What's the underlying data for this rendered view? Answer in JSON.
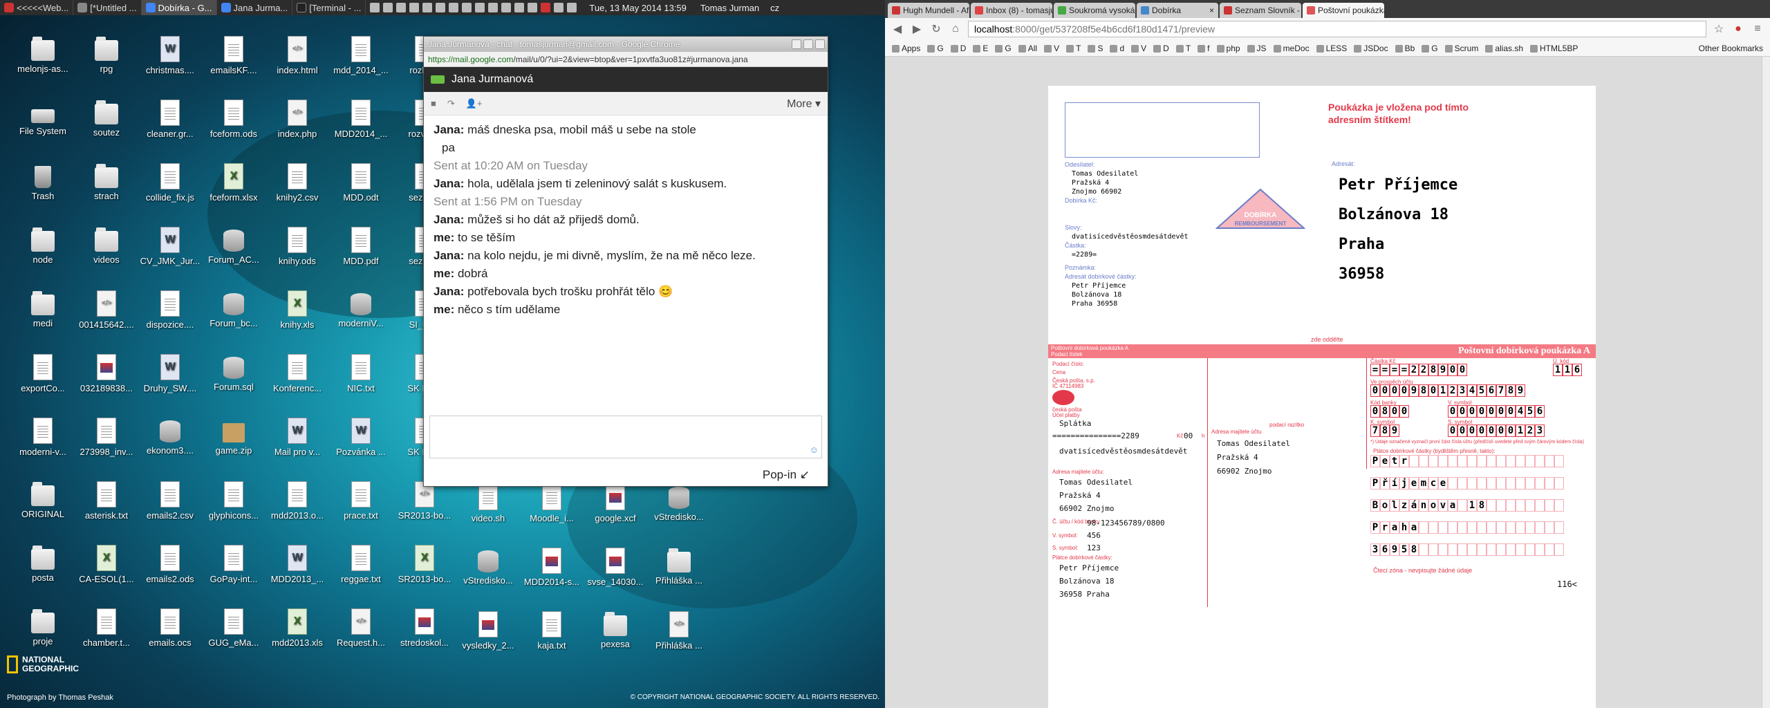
{
  "taskbar": {
    "items": [
      "<<<<<Web...",
      "[*Untitled ...",
      "Dobírka - G...",
      "Jana Jurma...",
      "[Terminal - ..."
    ],
    "clock": "Tue, 13 May 2014 13:59",
    "user": "Tomas Jurman",
    "lang": "cz"
  },
  "desktop": {
    "icons": [
      {
        "label": "melonjs-as...",
        "type": "folder"
      },
      {
        "label": "rpg",
        "type": "folder"
      },
      {
        "label": "christmas....",
        "type": "word"
      },
      {
        "label": "emailsKF....",
        "type": "doc"
      },
      {
        "label": "index.html",
        "type": "html"
      },
      {
        "label": "mdd_2014_...",
        "type": "doc"
      },
      {
        "label": "rozho...",
        "type": "doc"
      },
      {
        "label": "File System",
        "type": "drive"
      },
      {
        "label": "soutez",
        "type": "folder"
      },
      {
        "label": "cleaner.gr...",
        "type": "doc"
      },
      {
        "label": "fceform.ods",
        "type": "doc"
      },
      {
        "label": "index.php",
        "type": "html"
      },
      {
        "label": "MDD2014_...",
        "type": "doc"
      },
      {
        "label": "rozvrh...",
        "type": "doc"
      },
      {
        "label": "Trash",
        "type": "trash"
      },
      {
        "label": "strach",
        "type": "folder"
      },
      {
        "label": "collide_fix.js",
        "type": "doc"
      },
      {
        "label": "fceform.xlsx",
        "type": "sheet"
      },
      {
        "label": "knihy2.csv",
        "type": "doc"
      },
      {
        "label": "MDD.odt",
        "type": "doc"
      },
      {
        "label": "sezna...",
        "type": "doc"
      },
      {
        "label": "node",
        "type": "folder"
      },
      {
        "label": "videos",
        "type": "folder"
      },
      {
        "label": "CV_JMK_Jur...",
        "type": "word"
      },
      {
        "label": "Forum_AC...",
        "type": "db"
      },
      {
        "label": "knihy.ods",
        "type": "doc"
      },
      {
        "label": "MDD.pdf",
        "type": "doc"
      },
      {
        "label": "sezna...",
        "type": "doc"
      },
      {
        "label": "medi",
        "type": "folder"
      },
      {
        "label": "001415642....",
        "type": "html"
      },
      {
        "label": "dispozice....",
        "type": "doc"
      },
      {
        "label": "Forum_bc...",
        "type": "db"
      },
      {
        "label": "knihy.xls",
        "type": "sheet"
      },
      {
        "label": "moderniV...",
        "type": "db"
      },
      {
        "label": "SI_05...",
        "type": "doc"
      },
      {
        "label": "exportCo...",
        "type": "doc"
      },
      {
        "label": "032189838...",
        "type": "img"
      },
      {
        "label": "Druhy_SW....",
        "type": "word"
      },
      {
        "label": "Forum.sql",
        "type": "db"
      },
      {
        "label": "Konferenc...",
        "type": "doc"
      },
      {
        "label": "NIC.txt",
        "type": "doc"
      },
      {
        "label": "SK BA...",
        "type": "doc"
      },
      {
        "label": "moderni-v...",
        "type": "doc"
      },
      {
        "label": "273998_inv...",
        "type": "doc"
      },
      {
        "label": "ekonom3....",
        "type": "db"
      },
      {
        "label": "game.zip",
        "type": "zip"
      },
      {
        "label": "Mail pro v...",
        "type": "word"
      },
      {
        "label": "Pozvánka ...",
        "type": "word"
      },
      {
        "label": "SK BA...",
        "type": "doc"
      },
      {
        "label": "ORIGINAL",
        "type": "folder"
      },
      {
        "label": "asterisk.txt",
        "type": "doc"
      },
      {
        "label": "emails2.csv",
        "type": "doc"
      },
      {
        "label": "glyphicons...",
        "type": "doc"
      },
      {
        "label": "mdd2013.o...",
        "type": "doc"
      },
      {
        "label": "prace.txt",
        "type": "doc"
      },
      {
        "label": "SR2013-bo...",
        "type": "html"
      },
      {
        "label": "posta",
        "type": "folder"
      },
      {
        "label": "CA-ESOL(1...",
        "type": "sheet"
      },
      {
        "label": "emails2.ods",
        "type": "doc"
      },
      {
        "label": "GoPay-int...",
        "type": "doc"
      },
      {
        "label": "MDD2013_...",
        "type": "word"
      },
      {
        "label": "reggae.txt",
        "type": "doc"
      },
      {
        "label": "SR2013-bo...",
        "type": "sheet"
      },
      {
        "label": "proje",
        "type": "folder"
      },
      {
        "label": "chamber.t...",
        "type": "doc"
      },
      {
        "label": "emails.ocs",
        "type": "doc"
      },
      {
        "label": "GUG_eMa...",
        "type": "doc"
      },
      {
        "label": "mdd2013.xls",
        "type": "sheet"
      },
      {
        "label": "Request.h...",
        "type": "html"
      },
      {
        "label": "stredoskol...",
        "type": "img"
      }
    ],
    "extra_icons": [
      {
        "label": "video.sh",
        "type": "doc"
      },
      {
        "label": "Moodle_i...",
        "type": "doc"
      },
      {
        "label": "google.xcf",
        "type": "img"
      },
      {
        "label": "vStredisko...",
        "type": "db"
      },
      {
        "label": "vStredisko...",
        "type": "db"
      },
      {
        "label": "MDD2014-s...",
        "type": "img"
      },
      {
        "label": "svse_14030...",
        "type": "img"
      },
      {
        "label": "Přihláška ...",
        "type": "folder"
      },
      {
        "label": "vysledky_2...",
        "type": "img"
      },
      {
        "label": "kaja.txt",
        "type": "doc"
      },
      {
        "label": "pexesa",
        "type": "folder"
      },
      {
        "label": "Přihláška ...",
        "type": "html"
      }
    ],
    "natgeo_line1": "NATIONAL",
    "natgeo_line2": "GEOGRAPHIC",
    "photo_credit": "Photograph by Thomas Peshak",
    "copyright": "© COPYRIGHT NATIONAL GEOGRAPHIC SOCIETY. ALL RIGHTS RESERVED."
  },
  "chat": {
    "window_title": "Jana Jurmanová - chat - tomasjurman@gmail.com - Google Chrome",
    "url_secure": "https://mail.google.com",
    "url_rest": "/mail/u/0/?ui=2&view=btop&ver=1pxvtfa3uo81z#jurmanova.jana",
    "contact": "Jana Jurmanová",
    "more": "More ▾",
    "popin": "Pop-in ↙",
    "messages": [
      {
        "who": "Jana:",
        "text": "máš dneska psa, mobil máš u sebe na stole"
      },
      {
        "who": "",
        "text": "pa"
      },
      {
        "ts": "Sent at 10:20 AM on Tuesday"
      },
      {
        "who": "Jana:",
        "text": "hola, udělala jsem ti zeleninový salát s kuskusem."
      },
      {
        "ts": "Sent at 1:56 PM on Tuesday"
      },
      {
        "who": "Jana:",
        "text": "můžeš si ho dát až přijedš domů."
      },
      {
        "who": "me:",
        "text": "to se těším"
      },
      {
        "who": "Jana:",
        "text": "na kolo nejdu, je mi divně, myslím, že na mě něco leze."
      },
      {
        "who": "me:",
        "text": "dobrá"
      },
      {
        "who": "Jana:",
        "text": "potřebovala bych trošku prohřát tělo 😊"
      },
      {
        "who": "me:",
        "text": "něco s tím udělame"
      }
    ]
  },
  "browser": {
    "tabs": [
      "Hugh Mundell - Afric...",
      "Inbox (8) - tomasjurman@",
      "Soukromá vysoká škola ek...",
      "Dobírka",
      "Seznam Slovník - on-line p...",
      "Poštovní poukázka A - do..."
    ],
    "url_host": "localhost",
    "url_path": ":8000/get/537208f5e4b6cd6f180d1471/preview",
    "bookmarks": [
      "Apps",
      "G",
      "D",
      "E",
      "G",
      "All",
      "V",
      "T",
      "S",
      "d",
      "V",
      "D",
      "T",
      "f",
      "php",
      "JS",
      "meDoc",
      "LESS",
      "JSDoc",
      "Bb",
      "G",
      "Scrum",
      "alias.sh",
      "HTML5BP"
    ],
    "other_bookmarks": "Other Bookmarks"
  },
  "form": {
    "warn1": "Poukázka je vložena pod tímto",
    "warn2": "adresním štítkem!",
    "sender_label": "Odesílatel:",
    "sender": [
      "Tomas Odesilatel",
      "Pražská 4",
      "Znojmo 66902"
    ],
    "cod_label": "Dobírka Kč:",
    "words_label": "Slovy:",
    "words": "dvatisícedvěstěosmdesátdevět",
    "amount_label": "Částka:",
    "amount": "=2289=",
    "note_label": "Poznámka:",
    "payee_label": "Adresát dobírkové částky:",
    "payee": [
      "Petr Příjemce",
      "Bolzánova 18",
      "Praha 36958"
    ],
    "stamp1": "DOBÍRKA",
    "stamp2": "REMBOURSEMENT",
    "addressee_label": "Adresát:",
    "addressee": [
      "Petr Příjemce",
      "Bolzánova 18",
      "Praha",
      "36958"
    ],
    "cut": "zde oddělte",
    "band_left": "Poštovní dobírková poukázka A",
    "band_left2": "Podací lístek",
    "band_right": "Poštovní dobírková poukázka A",
    "post_label": "Podací číslo:",
    "cena": "Cena",
    "ceska_posta": "Česká pošta, s.p.",
    "ic": "IČ 47114983",
    "ceska_posta2": "česká pošta",
    "purpose_label": "Účel platby",
    "purpose": "Splátka",
    "kc_label": "Kč",
    "h_label": "h",
    "amount_line": "===============2289",
    "haler": "00",
    "words2": "dvatisícedvěstěosmdesátdevět",
    "owner_label": "Adresa majitele účtu:",
    "owner": [
      "Tomas Odesilatel",
      "Pražská 4",
      "66902 Znojmo"
    ],
    "account_label": "Č. účtu / kód banky",
    "account": "98-123456789/0800",
    "vs_label": "V. symbol:",
    "vs": "456",
    "ss_label": "S. symbol:",
    "ss": "123",
    "payer_label": "Plátce dobírkové částky:",
    "payer": [
      "Petr Příjemce",
      "Bolzánova 18",
      "36958 Praha"
    ],
    "stamp_label": "podací razítko",
    "mid_owner_label": "Adresa majitele účtu",
    "mid_owner": [
      "Tomas Odesilatel",
      "Pražská 4",
      "66902 Znojmo"
    ],
    "amount_digits_label": "Částka Kč",
    "amount_digits": "====228900",
    "kc_code_label": "Ú. kód",
    "kc_code": "116",
    "prefix_label": "Ve prospěch účtu",
    "account_digits": "0000980123456789",
    "bank_label": "Kód banky",
    "bank": "0800",
    "ks_label": "K. symbol",
    "ks": "789",
    "vs_digits_label": "V. symbol",
    "vs_digits": "0000000456",
    "ss_digits_label": "S. symbol",
    "ss_digits": "0000000123",
    "notice": "*) Údaje označené vyznačí první část čísla účtu (předčíslí uvedete před svým čárovým kódem čísla)",
    "payer_block_label": "Plátce dobírkové částky (bydlištěm přesně, takto):",
    "payer_grid": [
      "Petr",
      "Příjemce",
      "Bolzánova 18",
      "Praha",
      "36958"
    ],
    "reading_zone": "Čtecí zóna - nevpisujte žádné údaje",
    "code": "116<"
  }
}
